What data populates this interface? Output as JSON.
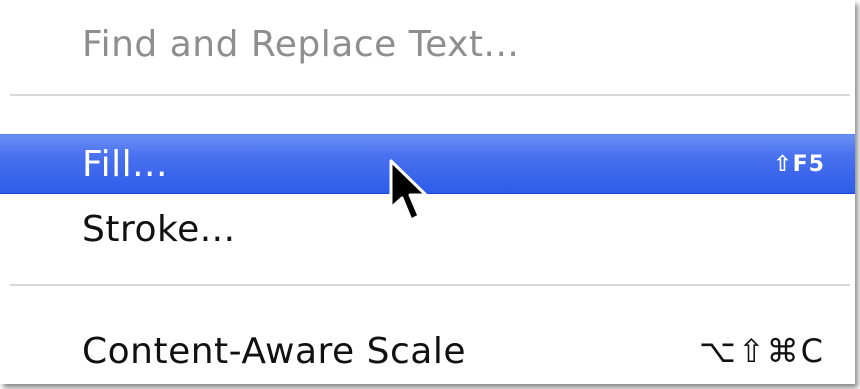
{
  "menu": {
    "items": [
      {
        "label": "Find and Replace Text...",
        "shortcut": "",
        "state": "disabled"
      },
      {
        "label": "Fill...",
        "shortcut": "⇧F5",
        "state": "highlighted"
      },
      {
        "label": "Stroke...",
        "shortcut": "",
        "state": "normal"
      },
      {
        "label": "Content-Aware Scale",
        "shortcut": "⌥⇧⌘C",
        "state": "normal"
      }
    ],
    "highlight_color": "#3b66ec",
    "disabled_color": "#8e8e8e",
    "cursor_icon": "arrow-cursor-icon"
  }
}
